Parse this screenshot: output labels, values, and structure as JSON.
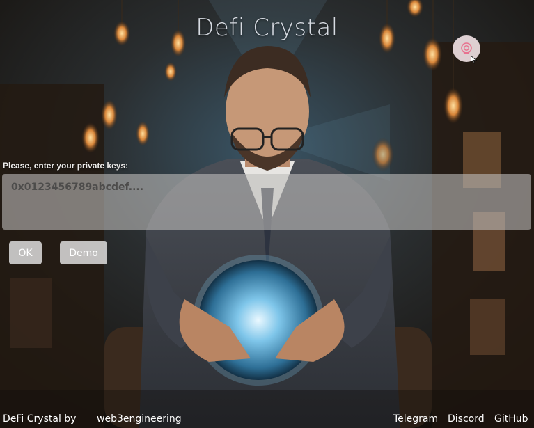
{
  "header": {
    "title": "Defi Crystal"
  },
  "theme_toggle": {
    "icon": "crystal-ball-icon",
    "color": "#e8728f"
  },
  "form": {
    "prompt": "Please, enter your private keys:",
    "placeholder": "0x0123456789abcdef...."
  },
  "buttons": {
    "ok": "OK",
    "demo": "Demo"
  },
  "footer": {
    "by_text": "DeFi Crystal by",
    "author": "web3engineering",
    "links": [
      "Telegram",
      "Discord",
      "GitHub"
    ]
  },
  "colors": {
    "title": "#d7dbe2",
    "input_bg": "#bebcba",
    "button_bg": "#dcdcdc"
  }
}
